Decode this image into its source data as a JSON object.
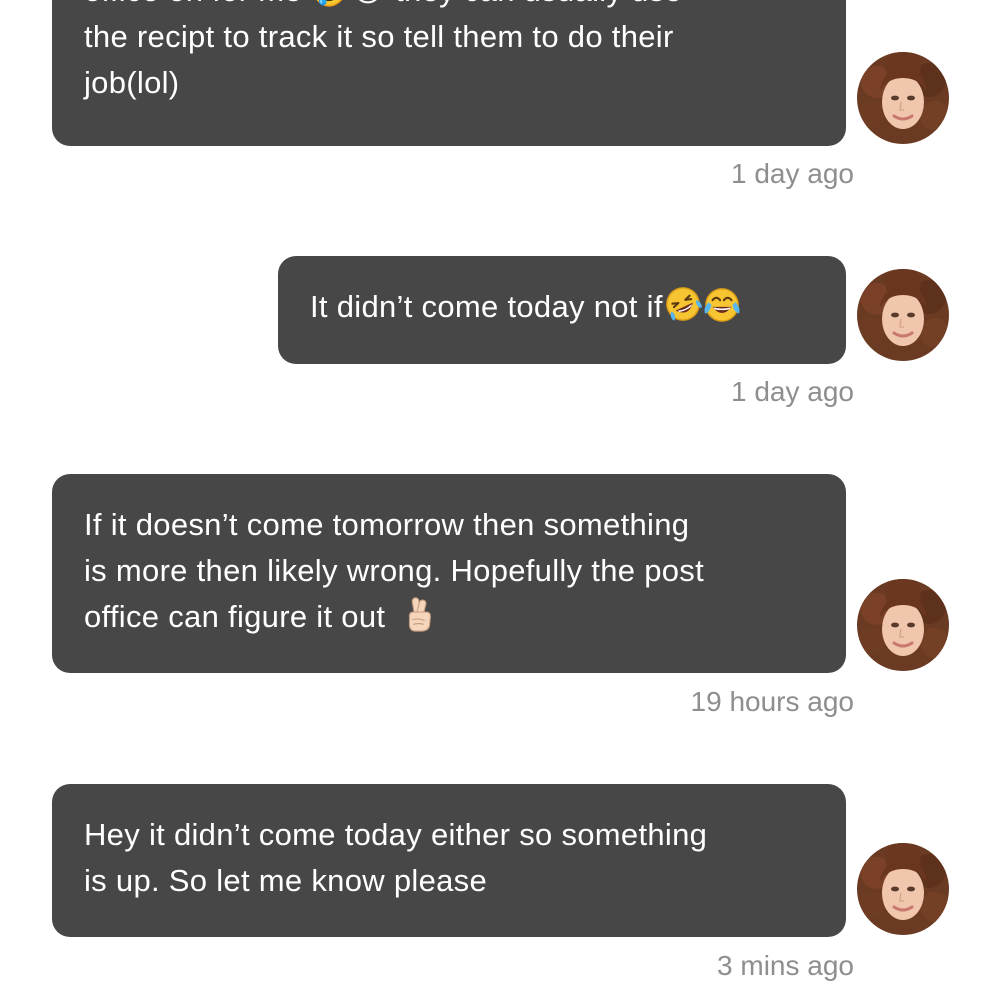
{
  "messages": [
    {
      "lines": [
        "office on for me 🤣😂 they can usually use",
        "the recipt to track it so tell them to do their",
        "job(lol)"
      ],
      "timestamp": "1 day ago"
    },
    {
      "lines": [
        "It didn’t come today not if"
      ],
      "timestamp": "1 day ago"
    },
    {
      "lines": [
        "If it doesn’t come tomorrow then something",
        "is more then likely wrong. Hopefully the post",
        "office can figure it out"
      ],
      "timestamp": "19 hours ago"
    },
    {
      "lines": [
        "Hey it didn’t come today either so something",
        "is up. So let me know please"
      ],
      "timestamp": "3 mins ago"
    }
  ],
  "icons": {
    "laugh_rolling": "rolling-on-floor-laughing-emoji",
    "tears_of_joy": "face-with-tears-of-joy-emoji",
    "crossed_fingers": "crossed-fingers-emoji"
  },
  "colors": {
    "bubble": "#474747",
    "bubble_text": "#ffffff",
    "timestamp": "#8e8e8e",
    "background": "#ffffff"
  }
}
